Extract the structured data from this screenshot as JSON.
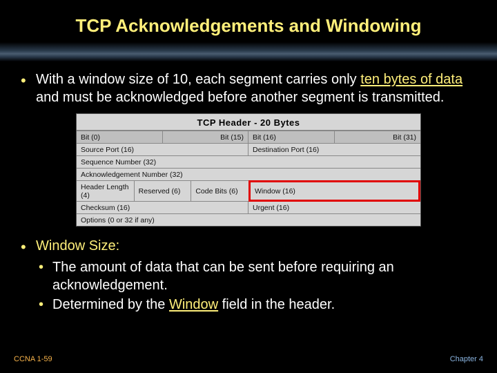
{
  "title": "TCP Acknowledgements and Windowing",
  "bullet1": {
    "prefix": "With a window size of 10, each segment carries only ",
    "kw1": "ten bytes of data",
    "mid": " and must be acknowledged before another segment is transmitted."
  },
  "diagram": {
    "title": "TCP Header - 20 Bytes",
    "header": {
      "b0": "Bit (0)",
      "b15": "Bit (15)",
      "b16": "Bit (16)",
      "b31": "Bit (31)"
    },
    "row1": {
      "left": "Source Port (16)",
      "right": "Destination Port (16)"
    },
    "row2": "Sequence Number (32)",
    "row3": "Acknowledgement Number (32)",
    "row4": {
      "a": "Header Length (4)",
      "b": "Reserved (6)",
      "c": "Code Bits (6)",
      "d": "Window (16)"
    },
    "row5": {
      "left": "Checksum (16)",
      "right": "Urgent (16)"
    },
    "row6": "Options (0 or 32 if any)"
  },
  "bullet2": {
    "label": "Window Size:",
    "sub1": "The amount of data that can be sent before requiring an acknowledgement.",
    "sub2_prefix": "Determined by the ",
    "sub2_kw": "Window",
    "sub2_suffix": " field in the header."
  },
  "footer": {
    "left": "CCNA 1-59",
    "right": "Chapter 4"
  }
}
